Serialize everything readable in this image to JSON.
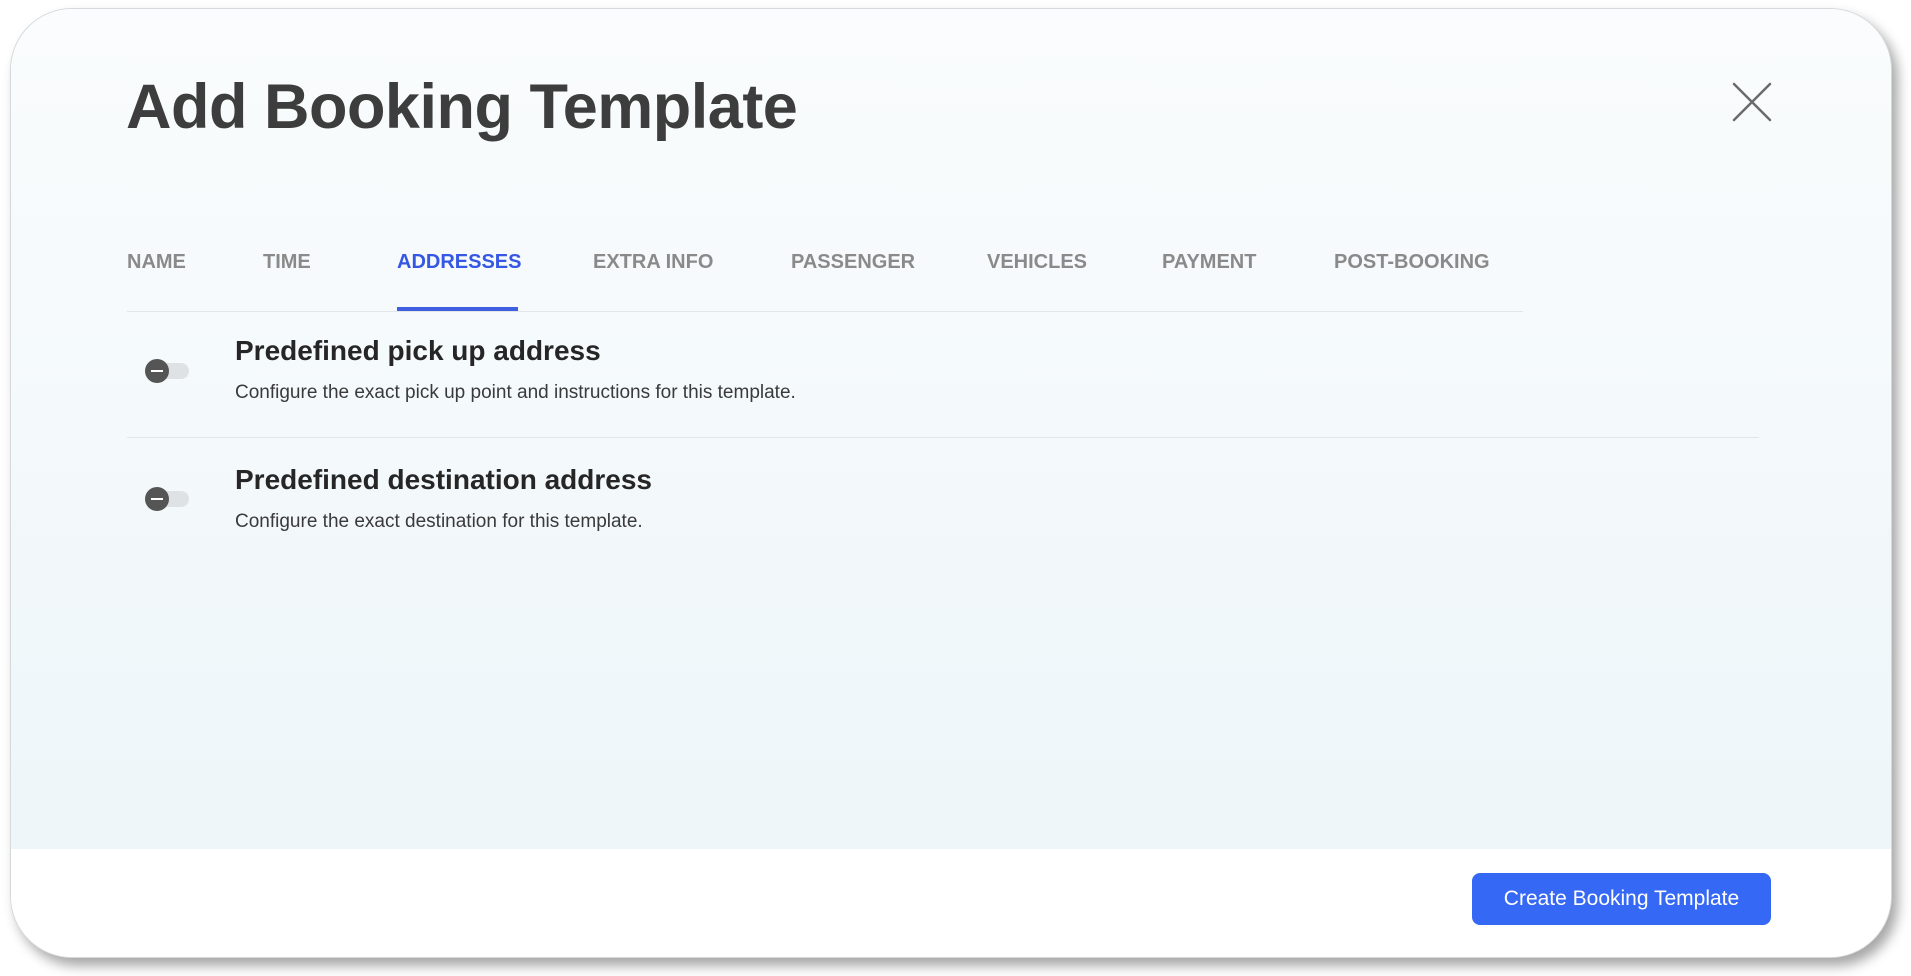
{
  "dialog": {
    "title": "Add Booking Template",
    "close_icon": "close-icon"
  },
  "tabs": [
    {
      "label": "NAME",
      "active": false
    },
    {
      "label": "TIME",
      "active": false
    },
    {
      "label": "ADDRESSES",
      "active": true
    },
    {
      "label": "EXTRA INFO",
      "active": false
    },
    {
      "label": "PASSENGER",
      "active": false
    },
    {
      "label": "VEHICLES",
      "active": false
    },
    {
      "label": "PAYMENT",
      "active": false
    },
    {
      "label": "POST-BOOKING",
      "active": false
    }
  ],
  "options": [
    {
      "title": "Predefined pick up address",
      "description": "Configure the exact pick up point and instructions for this template.",
      "enabled": false
    },
    {
      "title": "Predefined destination address",
      "description": "Configure the exact destination for this template.",
      "enabled": false
    }
  ],
  "footer": {
    "create_label": "Create Booking Template"
  },
  "colors": {
    "accent": "#3468f5",
    "active_tab": "#3557e4",
    "inactive_tab": "#8a8a8a",
    "title_text": "#3d3d3d"
  }
}
